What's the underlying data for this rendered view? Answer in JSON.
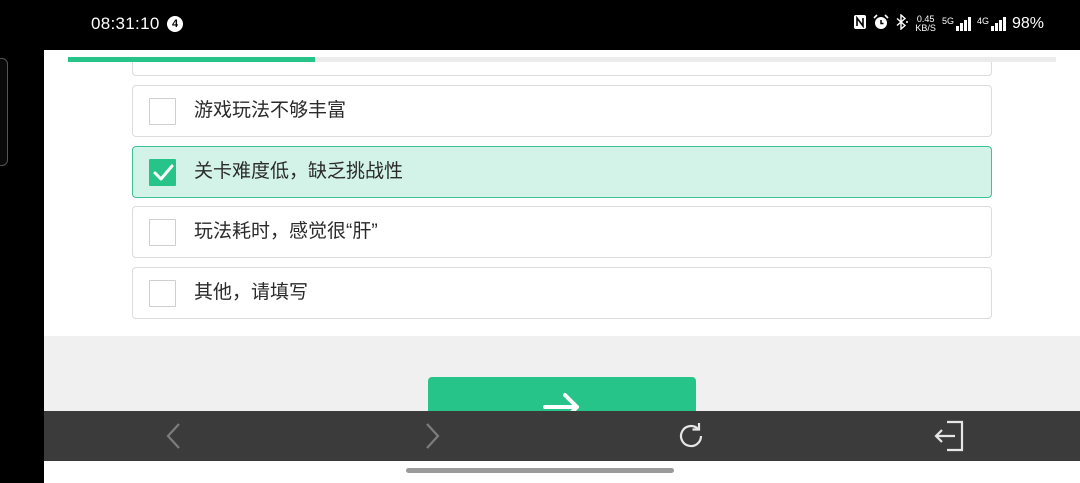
{
  "status_bar": {
    "time": "08:31:10",
    "notification_count": "4",
    "net_speed_value": "0.45",
    "net_speed_unit": "KB/S",
    "network_5g": "5G",
    "network_4g": "4G",
    "battery": "98%",
    "icons": [
      "nfc-icon",
      "alarm-icon",
      "bluetooth-icon",
      "signal-5g-icon",
      "signal-4g-icon"
    ]
  },
  "survey": {
    "progress": 0.25,
    "options": [
      {
        "label": "游戏玩法不够丰富",
        "checked": false
      },
      {
        "label": "关卡难度低，缺乏挑战性",
        "checked": true
      },
      {
        "label": "玩法耗时，感觉很“肝”",
        "checked": false
      },
      {
        "label": "其他，请填写",
        "checked": false
      }
    ],
    "next_button_icon": "arrow-right-icon"
  },
  "toolbar": {
    "icons": [
      "back-arrow-icon",
      "forward-arrow-icon",
      "refresh-icon",
      "exit-icon"
    ]
  },
  "colors": {
    "accent": "#26c489",
    "checked_bg": "#d3f3e8",
    "toolbar_bg": "#3b3b3b"
  }
}
